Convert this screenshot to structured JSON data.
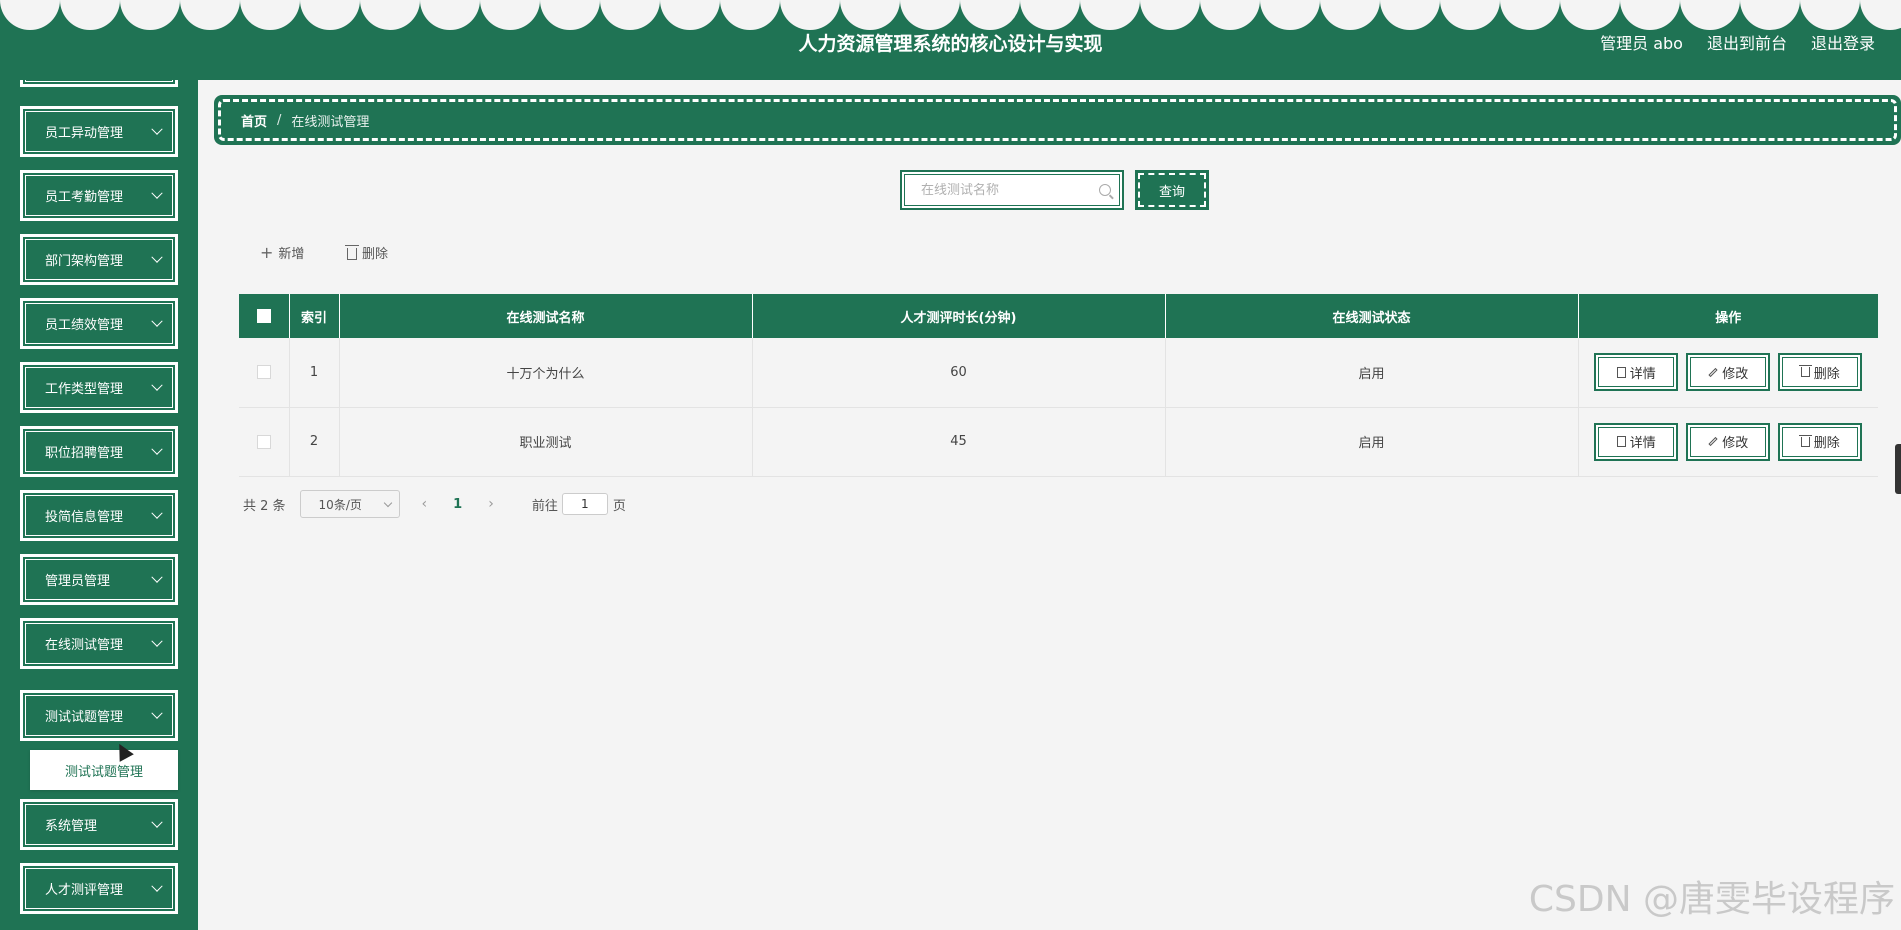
{
  "header": {
    "title": "人力资源管理系统的核心设计与实现",
    "user_label": "管理员 abo",
    "front_label": "退出到前台",
    "logout_label": "退出登录"
  },
  "sidebar": {
    "items": [
      {
        "label": "员工异动管理"
      },
      {
        "label": "员工考勤管理"
      },
      {
        "label": "部门架构管理"
      },
      {
        "label": "员工绩效管理"
      },
      {
        "label": "工作类型管理"
      },
      {
        "label": "职位招聘管理"
      },
      {
        "label": "投简信息管理"
      },
      {
        "label": "管理员管理"
      },
      {
        "label": "在线测试管理"
      },
      {
        "label": "测试试题管理"
      },
      {
        "label": "系统管理"
      },
      {
        "label": "人才测评管理"
      }
    ],
    "submenu_label": "测试试题管理"
  },
  "breadcrumb": {
    "home": "首页",
    "separator": "/",
    "current": "在线测试管理"
  },
  "search": {
    "placeholder": "在线测试名称",
    "value": "",
    "button_label": "查询"
  },
  "actions": {
    "add_label": "新增",
    "delete_label": "删除"
  },
  "table": {
    "columns": [
      "索引",
      "在线测试名称",
      "人才测评时长(分钟)",
      "在线测试状态",
      "操作"
    ],
    "rows": [
      {
        "index": "1",
        "name": "十万个为什么",
        "duration": "60",
        "status": "启用"
      },
      {
        "index": "2",
        "name": "职业测试",
        "duration": "45",
        "status": "启用"
      }
    ],
    "op_detail": "详情",
    "op_edit": "修改",
    "op_delete": "删除"
  },
  "pagination": {
    "total_label": "共 2 条",
    "page_size": "10条/页",
    "current_page": "1",
    "goto_label": "前往",
    "goto_value": "1",
    "page_unit": "页"
  },
  "watermark": "CSDN @唐雯毕设程序",
  "colors": {
    "primary": "#1f7354",
    "background": "#f4f4f4"
  }
}
